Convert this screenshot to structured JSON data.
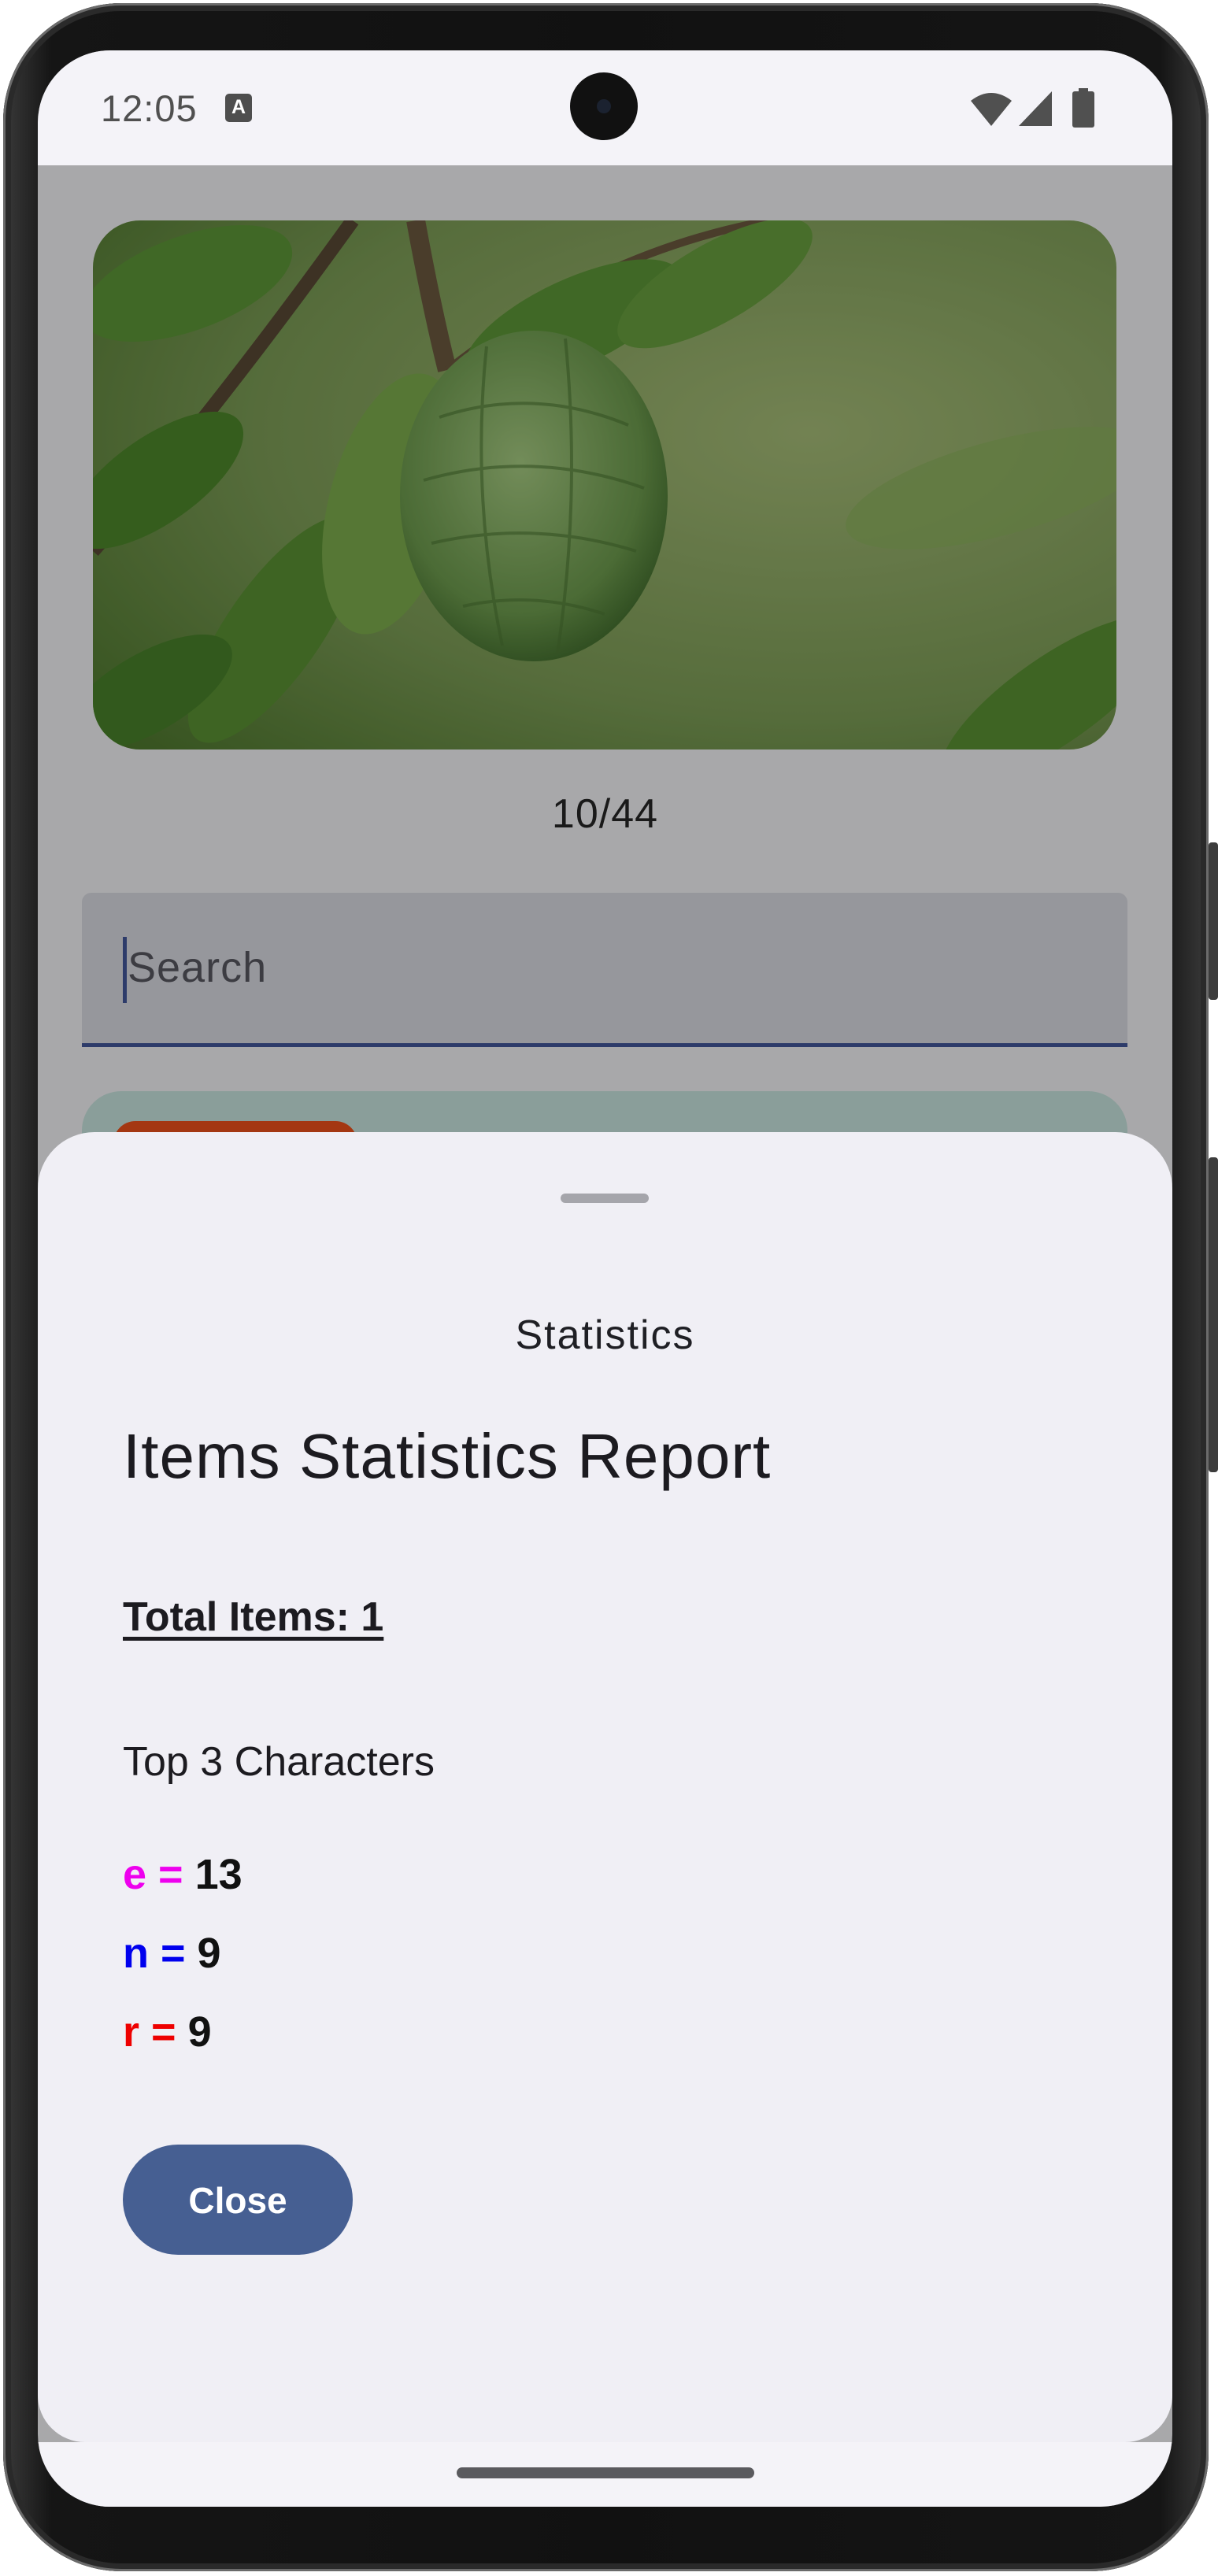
{
  "status_bar": {
    "time": "12:05",
    "notification_icon": "text-a-icon",
    "notification_glyph": "A",
    "icons": [
      "wifi-icon",
      "signal-icon",
      "battery-icon"
    ]
  },
  "gallery": {
    "image": "custard-apple-photo",
    "counter": "10/44"
  },
  "search": {
    "placeholder": "Search"
  },
  "bottom_sheet": {
    "title": "Statistics",
    "heading": "Items Statistics Report",
    "total_items": "Total Items: 1",
    "top_chars_label": "Top 3 Characters",
    "top_chars": [
      {
        "key": "e =",
        "value": "13",
        "color": "#ee00ee"
      },
      {
        "key": "n =",
        "value": "9",
        "color": "#0000ee"
      },
      {
        "key": "r =",
        "value": "9",
        "color": "#ee0000"
      }
    ],
    "close_label": "Close"
  },
  "colors": {
    "primary": "#465f92",
    "sheet_background": "#f0eff5",
    "scrim": "#a8a8aa"
  }
}
